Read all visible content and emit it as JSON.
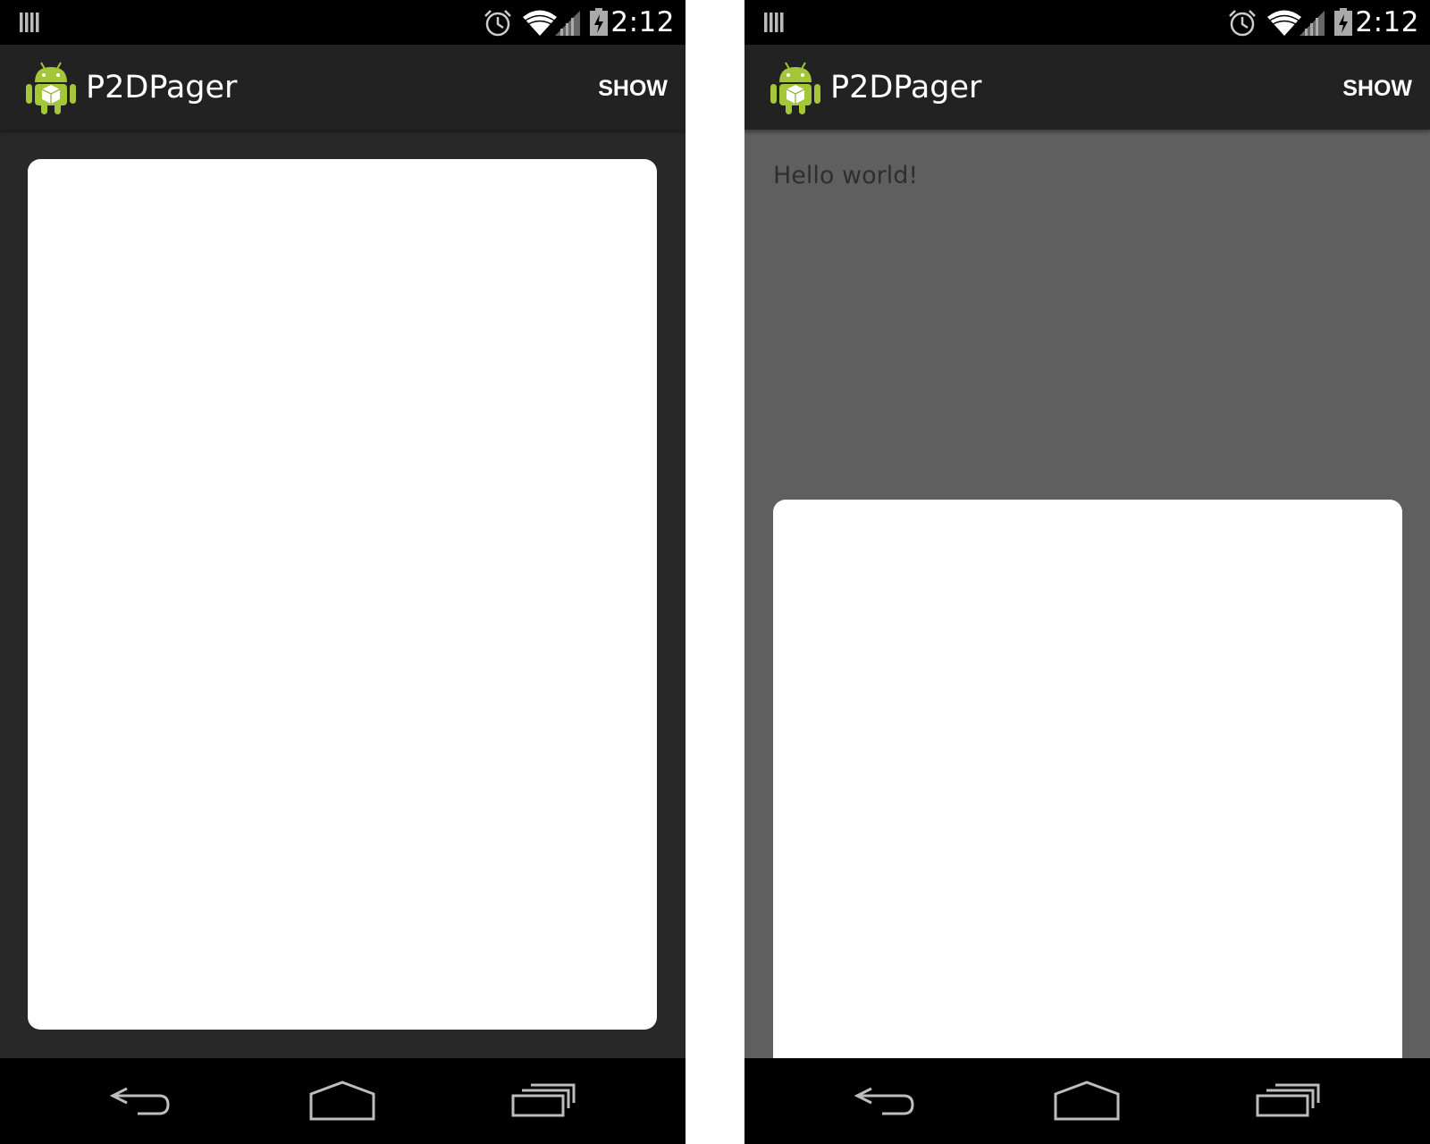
{
  "phones": [
    {
      "status_bar": {
        "time": "2:12",
        "icons": [
          "storage-icon",
          "alarm-icon",
          "wifi-icon",
          "signal-icon",
          "battery-charging-icon"
        ]
      },
      "action_bar": {
        "title": "P2DPager",
        "show_label": "SHOW",
        "app_icon": "android-robot-icon"
      },
      "content": {
        "background": "#282828",
        "card_color": "#ffffff"
      },
      "nav_bar": {
        "icons": [
          "back-icon",
          "home-icon",
          "recents-icon"
        ]
      }
    },
    {
      "status_bar": {
        "time": "2:12",
        "icons": [
          "storage-icon",
          "alarm-icon",
          "wifi-icon",
          "signal-icon",
          "battery-charging-icon"
        ]
      },
      "action_bar": {
        "title": "P2DPager",
        "show_label": "SHOW",
        "app_icon": "android-robot-icon"
      },
      "content": {
        "background": "#5f5f5f",
        "hello_text": "Hello world!",
        "card_color": "#ffffff"
      },
      "nav_bar": {
        "icons": [
          "back-icon",
          "home-icon",
          "recents-icon"
        ]
      }
    }
  ],
  "colors": {
    "status_bar": "#000000",
    "action_bar": "#222222",
    "nav_bar": "#000000",
    "android_green": "#a4c639"
  }
}
